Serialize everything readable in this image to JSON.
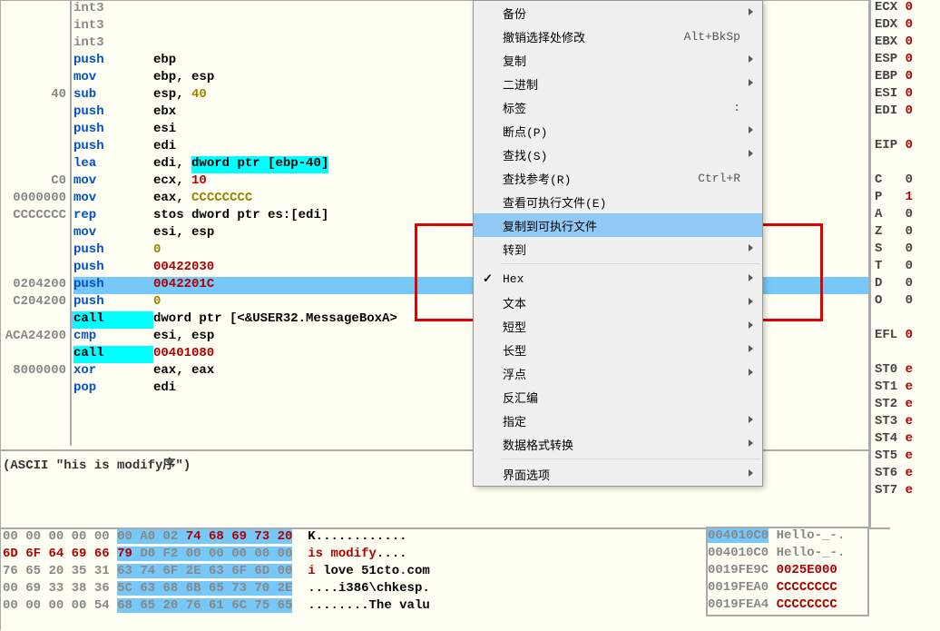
{
  "gutter": [
    "",
    "",
    "",
    "",
    "",
    "40",
    "",
    "",
    "",
    "",
    "C0",
    "0000000",
    "CCCCCCC",
    "",
    "",
    "",
    "0204200",
    "C204200",
    "",
    "ACA24200",
    "",
    "8000000",
    "",
    "",
    ""
  ],
  "code": [
    {
      "m": "int3",
      "mc": "gray",
      "ops": []
    },
    {
      "m": "int3",
      "mc": "gray",
      "ops": []
    },
    {
      "m": "int3",
      "mc": "gray",
      "ops": []
    },
    {
      "m": "push",
      "mc": "blue",
      "ops": [
        {
          "t": "ebp",
          "c": "op"
        }
      ]
    },
    {
      "m": "mov",
      "mc": "blue",
      "ops": [
        {
          "t": "ebp",
          "c": "op"
        },
        {
          "t": ", ",
          "c": "op"
        },
        {
          "t": "esp",
          "c": "op"
        }
      ]
    },
    {
      "m": "sub",
      "mc": "blue",
      "ops": [
        {
          "t": "esp",
          "c": "op"
        },
        {
          "t": ", ",
          "c": "op"
        },
        {
          "t": "40",
          "c": "op-gold"
        }
      ]
    },
    {
      "m": "push",
      "mc": "blue",
      "ops": [
        {
          "t": "ebx",
          "c": "op"
        }
      ]
    },
    {
      "m": "push",
      "mc": "blue",
      "ops": [
        {
          "t": "esi",
          "c": "op"
        }
      ]
    },
    {
      "m": "push",
      "mc": "blue",
      "ops": [
        {
          "t": "edi",
          "c": "op"
        }
      ]
    },
    {
      "m": "lea",
      "mc": "blue",
      "ops": [
        {
          "t": "edi",
          "c": "op"
        },
        {
          "t": ", ",
          "c": "op"
        },
        {
          "t": "dword ptr [ebp-40]",
          "c": "op-dword"
        }
      ]
    },
    {
      "m": "mov",
      "mc": "blue",
      "ops": [
        {
          "t": "ecx",
          "c": "op"
        },
        {
          "t": ", ",
          "c": "op"
        },
        {
          "t": "10",
          "c": "op-num"
        }
      ]
    },
    {
      "m": "mov",
      "mc": "blue",
      "ops": [
        {
          "t": "eax",
          "c": "op"
        },
        {
          "t": ", ",
          "c": "op"
        },
        {
          "t": "CCCCCCCC",
          "c": "op-gold"
        }
      ]
    },
    {
      "m": "rep",
      "mc": "blue",
      "ops": [
        {
          "t": "stos ",
          "c": "op"
        },
        {
          "t": "dword ptr es:[edi]",
          "c": "op"
        }
      ]
    },
    {
      "m": "mov",
      "mc": "blue",
      "ops": [
        {
          "t": "esi",
          "c": "op"
        },
        {
          "t": ", ",
          "c": "op"
        },
        {
          "t": "esp",
          "c": "op"
        }
      ]
    },
    {
      "m": "push",
      "mc": "blue",
      "ops": [
        {
          "t": "0",
          "c": "op-gold"
        }
      ]
    },
    {
      "m": "push",
      "mc": "blue",
      "ops": [
        {
          "t": "00422030",
          "c": "op-num"
        }
      ]
    },
    {
      "m": "push",
      "mc": "blue",
      "hl": true,
      "ops": [
        {
          "t": "0042201C",
          "c": "op-num"
        }
      ]
    },
    {
      "m": "push",
      "mc": "blue",
      "ops": [
        {
          "t": "0",
          "c": "op-gold"
        }
      ]
    },
    {
      "m": "call",
      "mc": "call",
      "ops": [
        {
          "t": "dword ptr [<&USER32.MessageBoxA>",
          "c": "op"
        }
      ]
    },
    {
      "m": "cmp",
      "mc": "blue",
      "ops": [
        {
          "t": "esi",
          "c": "op"
        },
        {
          "t": ", ",
          "c": "op"
        },
        {
          "t": "esp",
          "c": "op"
        }
      ]
    },
    {
      "m": "call",
      "mc": "call",
      "ops": [
        {
          "t": "00401080",
          "c": "op-num"
        }
      ]
    },
    {
      "m": "xor",
      "mc": "blue",
      "ops": [
        {
          "t": "eax",
          "c": "op"
        },
        {
          "t": ", ",
          "c": "op"
        },
        {
          "t": "eax",
          "c": "op"
        }
      ]
    },
    {
      "m": "pop",
      "mc": "blue",
      "ops": [
        {
          "t": "edi",
          "c": "op"
        }
      ]
    }
  ],
  "comment": "(ASCII \"his is modify序\")",
  "hex_rows": [
    {
      "bytes": [
        [
          "00",
          0,
          0
        ],
        [
          "00",
          0,
          0
        ],
        [
          "00",
          0,
          0
        ],
        [
          "00",
          0,
          0
        ],
        [
          "00",
          0,
          0
        ],
        [
          "00",
          0,
          1
        ],
        [
          "A0",
          0,
          1
        ],
        [
          "02",
          0,
          1
        ],
        [
          "74",
          1,
          1
        ],
        [
          "68",
          1,
          1
        ],
        [
          "69",
          1,
          1
        ],
        [
          "73",
          1,
          1
        ],
        [
          "20",
          1,
          1
        ]
      ],
      "ascii": [
        [
          "K",
          0
        ],
        [
          ".",
          0
        ],
        [
          ".",
          0
        ],
        [
          ".",
          0
        ],
        [
          ".",
          0
        ],
        [
          ".",
          0
        ],
        [
          ".",
          0
        ],
        [
          ".",
          0
        ],
        [
          ".",
          0
        ],
        [
          ".",
          0
        ],
        [
          ".",
          0
        ],
        [
          ".",
          0
        ],
        [
          ".",
          0
        ]
      ]
    },
    {
      "bytes": [
        [
          "6D",
          1,
          0
        ],
        [
          "6F",
          1,
          0
        ],
        [
          "64",
          1,
          0
        ],
        [
          "69",
          1,
          0
        ],
        [
          "66",
          1,
          0
        ],
        [
          "79",
          1,
          1
        ],
        [
          "D0",
          0,
          1
        ],
        [
          "F2",
          0,
          1
        ],
        [
          "00",
          0,
          1
        ],
        [
          "00",
          0,
          1
        ],
        [
          "00",
          0,
          1
        ],
        [
          "00",
          0,
          1
        ],
        [
          "00",
          0,
          1
        ]
      ],
      "ascii": [
        [
          "i",
          1
        ],
        [
          "s",
          1
        ],
        [
          " ",
          1
        ],
        [
          "m",
          1
        ],
        [
          "o",
          1
        ],
        [
          "d",
          1
        ],
        [
          "i",
          1
        ],
        [
          "f",
          1
        ],
        [
          "y",
          1
        ],
        [
          ".",
          0
        ],
        [
          ".",
          0
        ],
        [
          ".",
          0
        ],
        [
          ".",
          0
        ]
      ]
    },
    {
      "bytes": [
        [
          "76",
          0,
          0
        ],
        [
          "65",
          0,
          0
        ],
        [
          "20",
          0,
          0
        ],
        [
          "35",
          0,
          0
        ],
        [
          "31",
          0,
          0
        ],
        [
          "63",
          0,
          1
        ],
        [
          "74",
          0,
          1
        ],
        [
          "6F",
          0,
          1
        ],
        [
          "2E",
          0,
          1
        ],
        [
          "63",
          0,
          1
        ],
        [
          "6F",
          0,
          1
        ],
        [
          "6D",
          0,
          1
        ],
        [
          "00",
          0,
          1
        ]
      ],
      "ascii": [
        [
          "i",
          1
        ],
        [
          " ",
          1
        ],
        [
          "l",
          0
        ],
        [
          "o",
          0
        ],
        [
          "v",
          0
        ],
        [
          "e",
          0
        ],
        [
          " ",
          0
        ],
        [
          "5",
          0
        ],
        [
          "1",
          0
        ],
        [
          "c",
          0
        ],
        [
          "t",
          0
        ],
        [
          "o",
          0
        ],
        [
          ".",
          1
        ],
        [
          "c",
          0
        ],
        [
          "o",
          0
        ],
        [
          "m",
          0
        ]
      ]
    },
    {
      "bytes": [
        [
          "00",
          0,
          0
        ],
        [
          "69",
          0,
          0
        ],
        [
          "33",
          0,
          0
        ],
        [
          "38",
          0,
          0
        ],
        [
          "36",
          0,
          0
        ],
        [
          "5C",
          0,
          1
        ],
        [
          "63",
          0,
          1
        ],
        [
          "68",
          0,
          1
        ],
        [
          "6B",
          0,
          1
        ],
        [
          "65",
          0,
          1
        ],
        [
          "73",
          0,
          1
        ],
        [
          "70",
          0,
          1
        ],
        [
          "2E",
          0,
          1
        ]
      ],
      "ascii": [
        [
          ".",
          0
        ],
        [
          ".",
          0
        ],
        [
          ".",
          0
        ],
        [
          ".",
          0
        ],
        [
          "i",
          0
        ],
        [
          "3",
          0
        ],
        [
          "8",
          0
        ],
        [
          "6",
          0
        ],
        [
          "\\",
          0
        ],
        [
          "c",
          0
        ],
        [
          "h",
          0
        ],
        [
          "k",
          0
        ],
        [
          "e",
          0
        ],
        [
          "s",
          0
        ],
        [
          "p",
          0
        ],
        [
          ".",
          0
        ]
      ]
    },
    {
      "bytes": [
        [
          "00",
          0,
          0
        ],
        [
          "00",
          0,
          0
        ],
        [
          "00",
          0,
          0
        ],
        [
          "00",
          0,
          0
        ],
        [
          "54",
          0,
          0
        ],
        [
          "68",
          0,
          1
        ],
        [
          "65",
          0,
          1
        ],
        [
          "20",
          0,
          1
        ],
        [
          "76",
          0,
          1
        ],
        [
          "61",
          0,
          1
        ],
        [
          "6C",
          0,
          1
        ],
        [
          "75",
          0,
          1
        ],
        [
          "65",
          0,
          1
        ]
      ],
      "ascii": [
        [
          ".",
          0
        ],
        [
          ".",
          0
        ],
        [
          ".",
          0
        ],
        [
          ".",
          0
        ],
        [
          ".",
          0
        ],
        [
          ".",
          0
        ],
        [
          ".",
          0
        ],
        [
          ".",
          0
        ],
        [
          "T",
          0
        ],
        [
          "h",
          0
        ],
        [
          "e",
          0
        ],
        [
          " ",
          0
        ],
        [
          "v",
          0
        ],
        [
          "a",
          0
        ],
        [
          "l",
          0
        ],
        [
          "u",
          0
        ]
      ]
    }
  ],
  "registers": [
    {
      "n": "ECX",
      "v": "0"
    },
    {
      "n": "EDX",
      "v": "0"
    },
    {
      "n": "EBX",
      "v": "0"
    },
    {
      "n": "ESP",
      "v": "0"
    },
    {
      "n": "EBP",
      "v": "0"
    },
    {
      "n": "ESI",
      "v": "0"
    },
    {
      "n": "EDI",
      "v": "0"
    },
    {
      "n": "",
      "v": ""
    },
    {
      "n": "EIP",
      "v": "0"
    },
    {
      "n": "",
      "v": ""
    },
    {
      "n": "C",
      "v": "0",
      "z": true
    },
    {
      "n": "P",
      "v": "1"
    },
    {
      "n": "A",
      "v": "0",
      "z": true
    },
    {
      "n": "Z",
      "v": "0",
      "z": true
    },
    {
      "n": "S",
      "v": "0",
      "z": true
    },
    {
      "n": "T",
      "v": "0",
      "z": true
    },
    {
      "n": "D",
      "v": "0",
      "z": true
    },
    {
      "n": "O",
      "v": "0",
      "z": true
    },
    {
      "n": "",
      "v": ""
    },
    {
      "n": "EFL",
      "v": "0"
    },
    {
      "n": "",
      "v": ""
    },
    {
      "n": "ST0",
      "v": "e"
    },
    {
      "n": "ST1",
      "v": "e"
    },
    {
      "n": "ST2",
      "v": "e"
    },
    {
      "n": "ST3",
      "v": "e"
    },
    {
      "n": "ST4",
      "v": "e"
    },
    {
      "n": "ST5",
      "v": "e"
    },
    {
      "n": "ST6",
      "v": "e"
    },
    {
      "n": "ST7",
      "v": "e"
    }
  ],
  "stack": [
    {
      "addr": "004010C0",
      "val": "",
      "txt": "Hello-_-.",
      "sel": true
    },
    {
      "addr": "004010C0",
      "val": "",
      "txt": "Hello-_-."
    },
    {
      "addr": "0019FE9C",
      "val": "0025E000",
      "txt": ""
    },
    {
      "addr": "0019FEA0",
      "val": "CCCCCCCC",
      "txt": ""
    },
    {
      "addr": "0019FEA4",
      "val": "CCCCCCCC",
      "txt": ""
    }
  ],
  "menu": [
    {
      "label": "备份",
      "arrow": true
    },
    {
      "label": "撤销选择处修改",
      "shortcut": "Alt+BkSp"
    },
    {
      "label": "复制",
      "arrow": true
    },
    {
      "label": "二进制",
      "arrow": true
    },
    {
      "label": "标签",
      "shortcut": ":"
    },
    {
      "label": "断点(P)",
      "arrow": true
    },
    {
      "label": "查找(S)",
      "arrow": true
    },
    {
      "label": "查找参考(R)",
      "shortcut": "Ctrl+R"
    },
    {
      "label": "查看可执行文件(E)"
    },
    {
      "label": "复制到可执行文件",
      "active": true
    },
    {
      "label": "转到",
      "arrow": true
    },
    {
      "sep": true
    },
    {
      "label": "Hex",
      "check": true,
      "arrow": true
    },
    {
      "label": "文本",
      "arrow": true
    },
    {
      "label": "短型",
      "arrow": true
    },
    {
      "label": "长型",
      "arrow": true
    },
    {
      "label": "浮点",
      "arrow": true
    },
    {
      "label": "反汇编"
    },
    {
      "label": "指定",
      "arrow": true
    },
    {
      "label": "数据格式转换",
      "arrow": true
    },
    {
      "sep": true
    },
    {
      "label": "界面选项",
      "arrow": true
    }
  ]
}
